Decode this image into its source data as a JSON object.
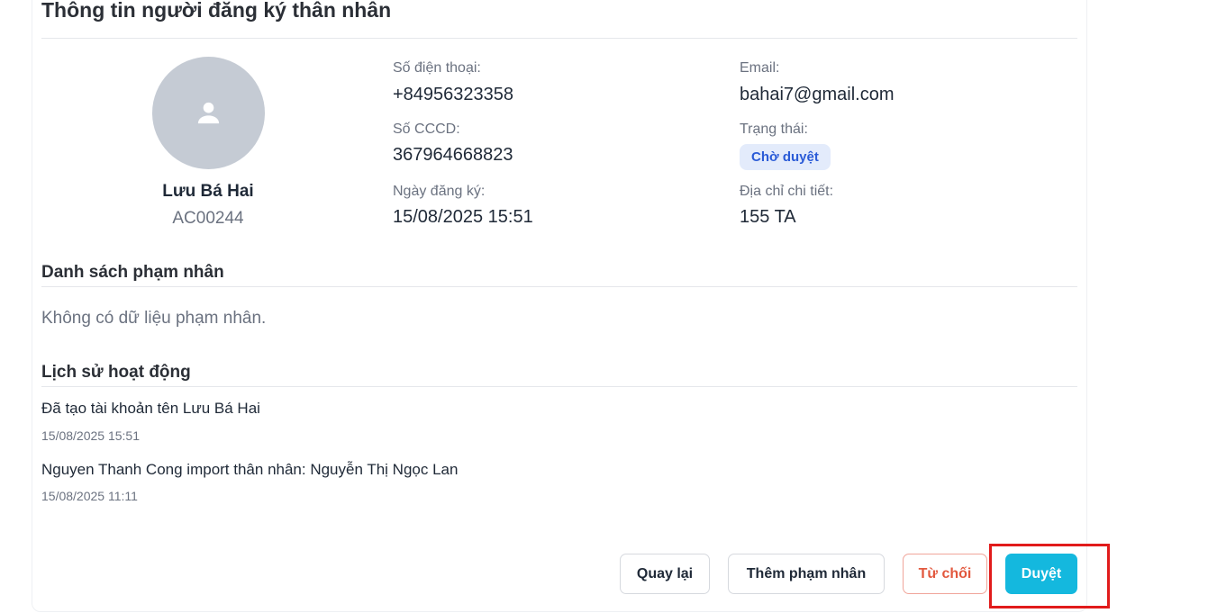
{
  "page": {
    "title": "Thông tin người đăng ký thân nhân"
  },
  "profile": {
    "avatar_icon": "user-icon",
    "name": "Lưu Bá Hai",
    "code": "AC00244"
  },
  "details": {
    "phone_label": "Số điện thoại:",
    "phone_value": "+84956323358",
    "email_label": "Email:",
    "email_value": "bahai7@gmail.com",
    "cccd_label": "Số CCCD:",
    "cccd_value": "367964668823",
    "status_label": "Trạng thái:",
    "status_value": "Chờ duyệt",
    "reg_date_label": "Ngày đăng ký:",
    "reg_date_value": "15/08/2025 15:51",
    "address_label": "Địa chỉ chi tiết:",
    "address_value": "155 TA"
  },
  "inmates": {
    "heading": "Danh sách phạm nhân",
    "empty_text": "Không có dữ liệu phạm nhân."
  },
  "history": {
    "heading": "Lịch sử hoạt động",
    "items": [
      {
        "text": "Đã tạo tài khoản tên Lưu Bá Hai",
        "time": "15/08/2025 15:51"
      },
      {
        "text": "Nguyen Thanh Cong import thân nhân: Nguyễn Thị Ngọc Lan",
        "time": "15/08/2025 11:11"
      }
    ]
  },
  "actions": {
    "back_label": "Quay lại",
    "add_inmate_label": "Thêm phạm nhân",
    "reject_label": "Từ chối",
    "approve_label": "Duyệt"
  },
  "colors": {
    "primary": "#14b8de",
    "danger": "#e2583e",
    "badge_bg": "#e3ebfb",
    "badge_text": "#2a5bd7",
    "highlight": "#e11b1b"
  }
}
